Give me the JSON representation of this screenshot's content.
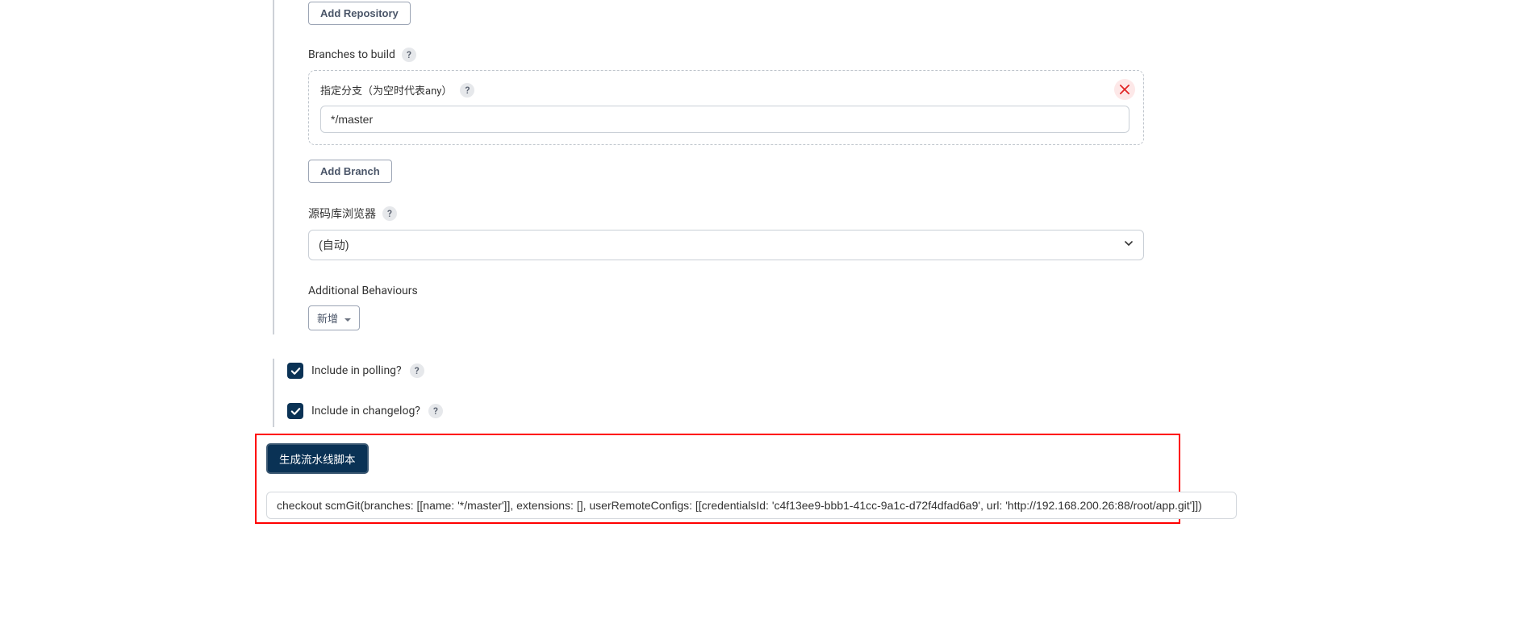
{
  "buttons": {
    "add_repository": "Add Repository",
    "add_branch": "Add Branch",
    "new_add": "新增",
    "generate_script": "生成流水线脚本"
  },
  "sections": {
    "branches_to_build": "Branches to build",
    "branch_specifier": "指定分支（为空时代表any）",
    "source_browser": "源码库浏览器",
    "additional_behaviours": "Additional Behaviours"
  },
  "inputs": {
    "branch_value": "*/master",
    "browser_value": "(自动)"
  },
  "checkboxes": {
    "include_polling": "Include in polling?",
    "include_changelog": "Include in changelog?"
  },
  "output": {
    "script": "checkout scmGit(branches: [[name: '*/master']], extensions: [], userRemoteConfigs: [[credentialsId: 'c4f13ee9-bbb1-41cc-9a1c-d72f4dfad6a9', url: 'http://192.168.200.26:88/root/app.git']])"
  }
}
